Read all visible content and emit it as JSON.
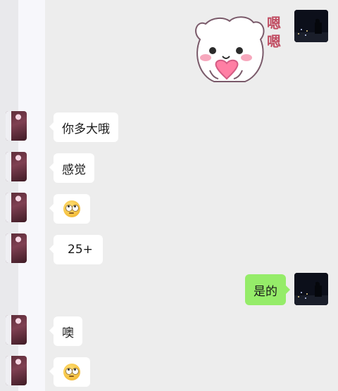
{
  "chat": {
    "sticker": {
      "text_line1": "嗯",
      "text_line2": "嗯",
      "icon": "bear-heart-sticker"
    },
    "messages": [
      {
        "side": "left",
        "text": "你多大哦"
      },
      {
        "side": "left",
        "text": "感觉"
      },
      {
        "side": "left",
        "text": "",
        "icon": "eye-roll-emoji"
      },
      {
        "side": "left",
        "text": "25+"
      },
      {
        "side": "right",
        "text": "是的"
      },
      {
        "side": "left",
        "text": "噢"
      },
      {
        "side": "left",
        "text": "",
        "icon": "eye-roll-emoji"
      }
    ]
  },
  "colors": {
    "background": "#ededed",
    "incoming_bubble": "#ffffff",
    "outgoing_bubble": "#95ec69"
  }
}
